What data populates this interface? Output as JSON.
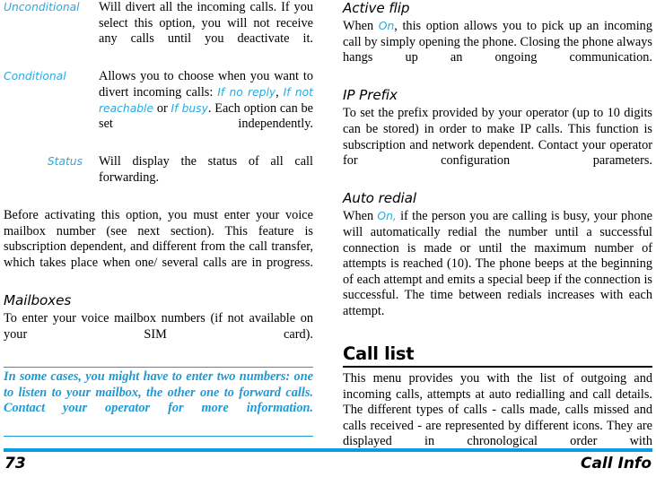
{
  "page": {
    "number": "73",
    "footer_title": "Call Info",
    "accent_blue": "#29A8E0",
    "rule_blue": "#0D9BDE",
    "note_blue": "#1C9AD6"
  },
  "left_column": {
    "definitions": [
      {
        "term": "Unconditional",
        "desc": "Will divert all the incoming calls. If you select this option, you will not receive any calls until you deactivate it."
      },
      {
        "term": "Conditional",
        "desc_part1": "Allows you to choose when you want to divert incoming calls: ",
        "opt1": "If no reply",
        "sep1": ", ",
        "opt2": "If not reachable",
        "sep2": " or ",
        "opt3": "If busy",
        "desc_part2": ". Each option can be set independently."
      },
      {
        "term": "Status",
        "desc": "Will display the status of all call forwarding."
      }
    ],
    "paragraph_before": "Before activating this option, you must enter your voice mailbox number (see next section). This feature is subscription dependent, and different from the call transfer, which takes place when one/ several calls are in progress.",
    "mailboxes_heading": "Mailboxes",
    "mailboxes_text": "To enter your voice mailbox numbers (if not available on your SIM card).",
    "note": "In some cases, you might have to enter two numbers: one to listen to your mailbox, the other one to forward calls. Contact your operator for more information."
  },
  "right_column": {
    "active_flip": {
      "heading": "Active flip",
      "text_part1": "When ",
      "option": "On",
      "text_part2": ", this option allows you to pick up an incoming call by simply opening the phone. Closing the phone always hangs up an ongoing communication."
    },
    "ip_prefix": {
      "heading": "IP Prefix",
      "text": "To set the prefix provided by your operator (up to 10 digits can be stored) in order to make IP calls. This function is subscription and network dependent. Contact your operator for configuration parameters."
    },
    "auto_redial": {
      "heading": "Auto redial",
      "text_part1": "When ",
      "option": "On,",
      "text_part2": " if the person you are calling is busy, your phone will automatically redial the number until a successful connection is made or until the maximum number of attempts is reached (10). The phone beeps at the beginning of each attempt and emits a special beep if the connection is successful. The time between redials increases with each attempt."
    },
    "call_list": {
      "heading": "Call list",
      "text": "This menu provides you with the list of outgoing and incoming calls, attempts at auto redialling and call details. The different types of calls - calls made, calls missed and calls received - are represented by different icons. They are displayed in chronological order with"
    }
  }
}
